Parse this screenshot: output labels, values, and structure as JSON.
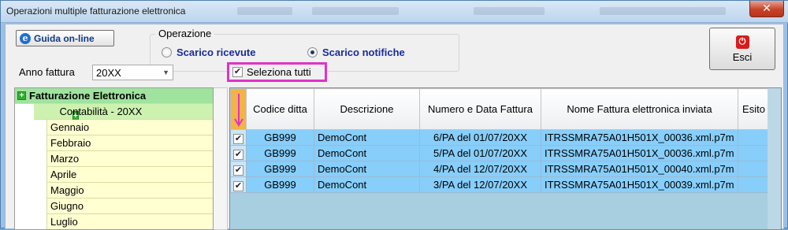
{
  "window": {
    "title": "Operazioni multiple fatturazione elettronica",
    "close_symbol": "✕"
  },
  "toolbar": {
    "guida_label": "Guida on-line",
    "esci_label": "Esci"
  },
  "operazione": {
    "legend": "Operazione",
    "options": [
      {
        "label": "Scarico ricevute",
        "selected": false
      },
      {
        "label": "Scarico notifiche",
        "selected": true
      }
    ]
  },
  "anno": {
    "label": "Anno fattura",
    "value": "20XX"
  },
  "select_all": {
    "label": "Seleziona tutti",
    "checked": true
  },
  "tree": {
    "root": "Fatturazione Elettronica",
    "level1": "Contabilità - 20XX",
    "months": [
      "Gennaio",
      "Febbraio",
      "Marzo",
      "Aprile",
      "Maggio",
      "Giugno",
      "Luglio"
    ]
  },
  "grid": {
    "columns": [
      "Codice ditta",
      "Descrizione",
      "Numero e Data Fattura",
      "Nome Fattura elettronica inviata",
      "Esito"
    ],
    "rows": [
      {
        "checked": true,
        "codice": "GB999",
        "descrizione": "DemoCont",
        "numero": "6/PA del 01/07/20XX",
        "nome": "ITRSSMRA75A01H501X_00036.xml.p7m",
        "esito": ""
      },
      {
        "checked": true,
        "codice": "GB999",
        "descrizione": "DemoCont",
        "numero": "5/PA del 01/07/20XX",
        "nome": "ITRSSMRA75A01H501X_00036.xml.p7m",
        "esito": ""
      },
      {
        "checked": true,
        "codice": "GB999",
        "descrizione": "DemoCont",
        "numero": "4/PA del 12/07/20XX",
        "nome": "ITRSSMRA75A01H501X_00040.xml.p7m",
        "esito": ""
      },
      {
        "checked": true,
        "codice": "GB999",
        "descrizione": "DemoCont",
        "numero": "3/PA del 12/07/20XX",
        "nome": "ITRSSMRA75A01H501X_00039.xml.p7m",
        "esito": ""
      }
    ]
  },
  "colors": {
    "highlight": "#e032c8",
    "row_selected": "#87cefa",
    "tree_root": "#9fe39f",
    "tree_month": "#ffffd2"
  }
}
